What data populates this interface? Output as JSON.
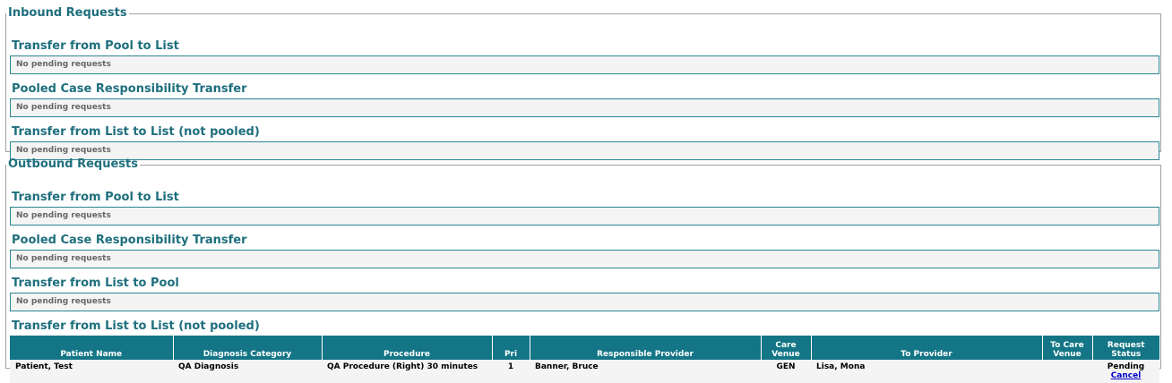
{
  "inbound": {
    "legend": "Inbound Requests",
    "sections": [
      {
        "title": "Transfer from Pool to List",
        "empty": "No pending requests"
      },
      {
        "title": "Pooled Case Responsibility Transfer",
        "empty": "No pending requests"
      },
      {
        "title": "Transfer from List to List (not pooled)",
        "empty": "No pending requests"
      }
    ]
  },
  "outbound": {
    "legend": "Outbound Requests",
    "sections": [
      {
        "title": "Transfer from Pool to List",
        "empty": "No pending requests"
      },
      {
        "title": "Pooled Case Responsibility Transfer",
        "empty": "No pending requests"
      },
      {
        "title": "Transfer from List to Pool",
        "empty": "No pending requests"
      }
    ],
    "table_section": {
      "title": "Transfer from List to List (not pooled)",
      "columns": [
        "Patient Name",
        "Diagnosis Category",
        "Procedure",
        "Pri",
        "Responsible Provider",
        "Care Venue",
        "To Provider",
        "To Care Venue",
        "Request Status"
      ],
      "rows": [
        {
          "patient": "Patient, Test",
          "diagnosis": "QA Diagnosis",
          "procedure": "QA Procedure (Right) 30 minutes",
          "pri": "1",
          "provider": "Banner, Bruce",
          "venue": "GEN",
          "to_provider": "Lisa, Mona",
          "to_venue": "",
          "status": "Pending",
          "action": "Cancel"
        }
      ]
    }
  }
}
